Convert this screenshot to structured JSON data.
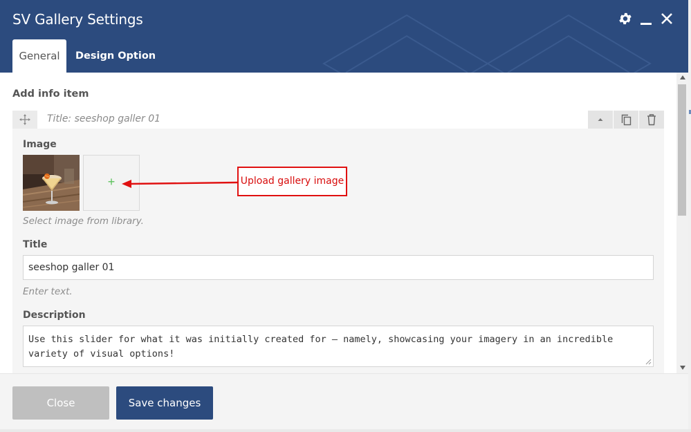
{
  "window": {
    "title": "SV Gallery Settings",
    "controls": [
      "gear-icon",
      "minimize-icon",
      "close-icon"
    ]
  },
  "tabs": [
    {
      "label": "General",
      "active": true
    },
    {
      "label": "Design Option",
      "active": false
    }
  ],
  "section": {
    "label": "Add info item"
  },
  "item": {
    "title": "Title: seeshop galler 01",
    "head_buttons": [
      "collapse-icon",
      "duplicate-icon",
      "delete-icon"
    ]
  },
  "fields": {
    "image": {
      "label": "Image",
      "help": "Select image from library.",
      "add_symbol": "+"
    },
    "title": {
      "label": "Title",
      "value": "seeshop galler 01",
      "help": "Enter text."
    },
    "description": {
      "label": "Description",
      "value": "Use this slider for what it was initially created for – namely, showcasing your imagery in an incredible variety of visual options!"
    }
  },
  "annotation": {
    "text": "Upload gallery image",
    "color": "#e01010"
  },
  "footer": {
    "close_label": "Close",
    "save_label": "Save changes"
  },
  "colors": {
    "brand": "#2c4b7e",
    "close_button": "#bfbfbf",
    "add_icon": "#5cc25c"
  }
}
